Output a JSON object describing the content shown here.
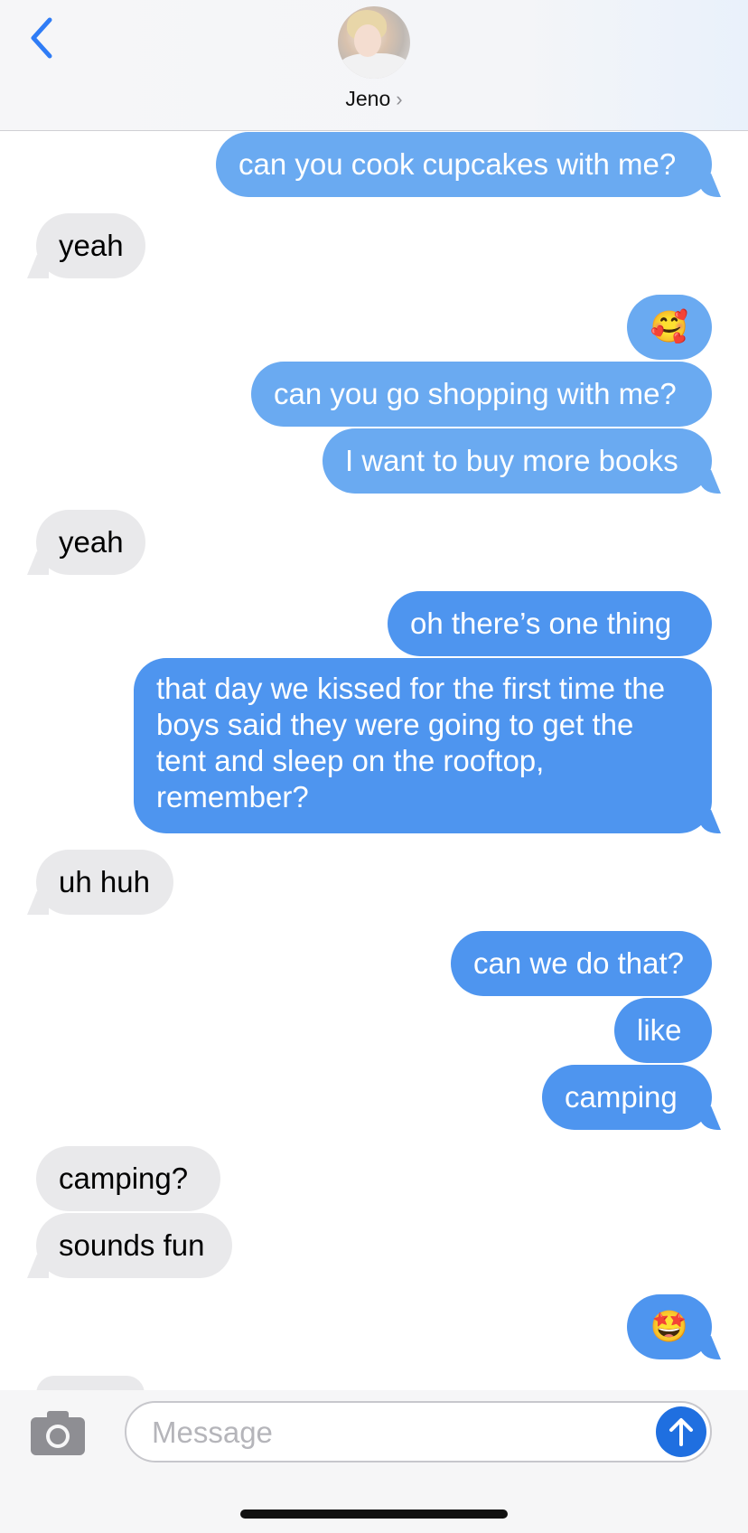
{
  "header": {
    "contact_name": "Jeno",
    "chevron": "›"
  },
  "messages": [
    {
      "side": "out",
      "text": "can you cook cupcakes with me?"
    },
    {
      "side": "in",
      "text": "yeah"
    },
    {
      "side": "out",
      "text": "🥰",
      "emoji": true
    },
    {
      "side": "out",
      "text": "can you go shopping with me?"
    },
    {
      "side": "out",
      "text": "I want to buy more books"
    },
    {
      "side": "in",
      "text": "yeah"
    },
    {
      "side": "out",
      "text": "oh there’s one thing"
    },
    {
      "side": "out",
      "text": "that day we kissed for the first time the boys said they were going to get the tent and sleep on the rooftop, remember?"
    },
    {
      "side": "in",
      "text": "uh huh"
    },
    {
      "side": "out",
      "text": "can we do that?"
    },
    {
      "side": "out",
      "text": "like"
    },
    {
      "side": "out",
      "text": "camping"
    },
    {
      "side": "in",
      "text": "camping?"
    },
    {
      "side": "in",
      "text": "sounds fun"
    },
    {
      "side": "out",
      "text": "🤩",
      "emoji": true
    }
  ],
  "composer": {
    "placeholder": "Message",
    "value": ""
  },
  "icons": {
    "back": "back-chevron-icon",
    "camera": "camera-icon",
    "send": "send-arrow-up-icon"
  },
  "colors": {
    "accent": "#2f7cf6",
    "outgoing_bubble": "#4e95ef",
    "incoming_bubble": "#e9e9eb",
    "send_button": "#1f6fe0"
  }
}
